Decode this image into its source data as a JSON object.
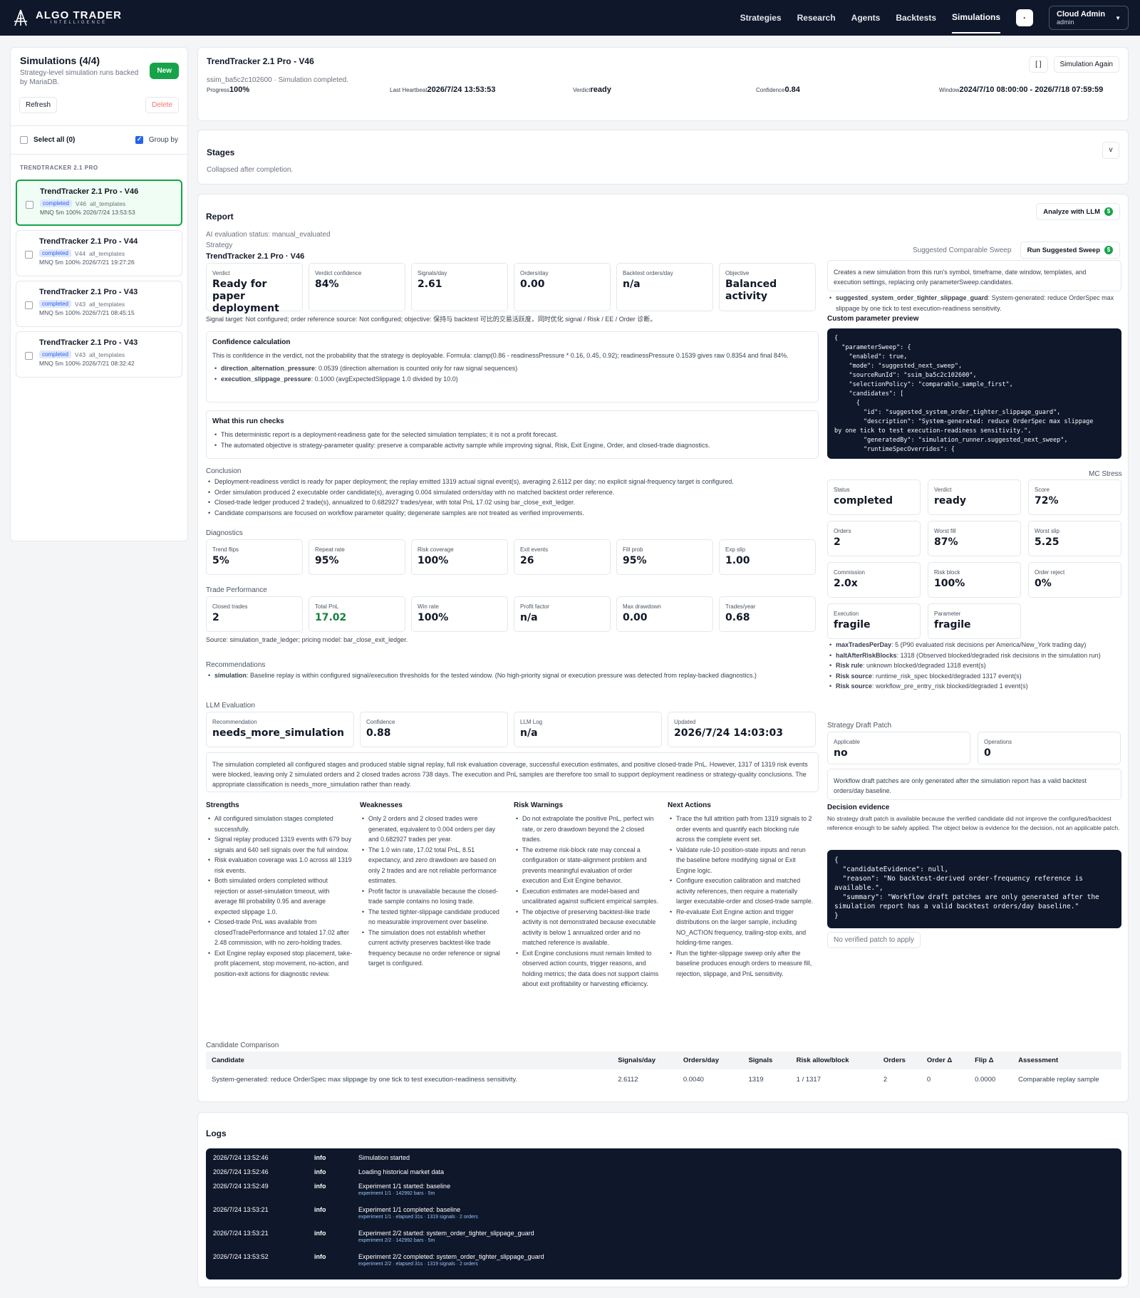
{
  "app": {
    "brand": "ALGO TRADER",
    "brand_sub": "INTELLIGENCE"
  },
  "nav": [
    "Strategies",
    "Research",
    "Agents",
    "Backtests",
    "Simulations"
  ],
  "nav_dot": "·",
  "user": {
    "name": "Cloud Admin",
    "role": "admin"
  },
  "sidebar": {
    "title": "Simulations (4/4)",
    "subtitle": "Strategy-level simulation runs backed by MariaDB.",
    "new": "New",
    "refresh": "Refresh",
    "delete": "Delete",
    "select_all": "Select all (0)",
    "group_by": "Group by",
    "group": "TRENDTRACKER 2.1 PRO",
    "items": [
      {
        "title": "TrendTracker 2.1 Pro - V46",
        "status": "completed",
        "ver": "V46",
        "tpl": "all_templates",
        "line": "MNQ  5m  100%  2026/7/24 13:53:53"
      },
      {
        "title": "TrendTracker 2.1 Pro - V44",
        "status": "completed",
        "ver": "V44",
        "tpl": "all_templates",
        "line": "MNQ  5m  100%  2026/7/21 19:27:26"
      },
      {
        "title": "TrendTracker 2.1 Pro - V43",
        "status": "completed",
        "ver": "V43",
        "tpl": "all_templates",
        "line": "MNQ  5m  100%  2026/7/21 08:45:15"
      },
      {
        "title": "TrendTracker 2.1 Pro - V43",
        "status": "completed",
        "ver": "V43",
        "tpl": "all_templates",
        "line": "MNQ  5m  100%  2026/7/21 08:32:42"
      }
    ]
  },
  "header": {
    "title": "TrendTracker 2.1 Pro - V46",
    "run": "ssim_ba5c2c102600 · Simulation completed.",
    "progress_lbl": "Progress",
    "progress": "100%",
    "hb_lbl": "Last Heartbeat",
    "hb": "2026/7/24 13:53:53",
    "verdict_lbl": "Verdict",
    "verdict": "ready",
    "conf_lbl": "Confidence",
    "conf": "0.84",
    "window_lbl": "Window",
    "window": "2024/7/10 08:00:00 - 2026/7/18 07:59:59",
    "expand": "[ ]",
    "again": "Simulation Again"
  },
  "stages": {
    "title": "Stages",
    "note": "Collapsed after completion.",
    "toggle": "v"
  },
  "report": {
    "title": "Report",
    "analyze": "Analyze with LLM",
    "analyze_icon": "$",
    "eval_status": "AI evaluation status: manual_evaluated",
    "strategy_lbl": "Strategy",
    "strategy": "TrendTracker 2.1 Pro · V46",
    "kpis": [
      {
        "l": "Verdict",
        "v": "Ready for paper deployment"
      },
      {
        "l": "Verdict confidence",
        "v": "84%"
      },
      {
        "l": "Signals/day",
        "v": "2.61"
      },
      {
        "l": "Orders/day",
        "v": "0.00"
      },
      {
        "l": "Backtest orders/day",
        "v": "n/a"
      },
      {
        "l": "Objective",
        "v": "Balanced activity"
      }
    ],
    "signal_target": "Signal target: Not configured; order reference source: Not configured; objective: 保持与 backtest 可比的交易活跃度，同时优化 signal / Risk / EE / Order 诊断。",
    "conf_calc": {
      "title": "Confidence calculation",
      "text": "This is confidence in the verdict, not the probability that the strategy is deployable. Formula: clamp(0.86 - readinessPressure * 0.16, 0.45, 0.92); readinessPressure 0.1539 gives raw 0.8354 and final 84%.",
      "items": [
        {
          "k": "direction_alternation_pressure",
          "v": ": 0.0539 (direction alternation is counted only for raw signal sequences)"
        },
        {
          "k": "execution_slippage_pressure",
          "v": ": 0.1000 (avgExpectedSlippage 1.0 divided by 10.0)"
        }
      ]
    },
    "checks": {
      "title": "What this run checks",
      "items": [
        "This deterministic report is a deployment-readiness gate for the selected simulation templates; it is not a profit forecast.",
        "The automated objective is strategy-parameter quality: preserve a comparable activity sample while improving signal, Risk, Exit Engine, Order, and closed-trade diagnostics."
      ]
    },
    "conclusion_lbl": "Conclusion",
    "conclusion": [
      "Deployment-readiness verdict is ready for paper deployment; the replay emitted 1319 actual signal event(s), averaging 2.6112 per day; no explicit signal-frequency target is configured.",
      "Order simulation produced 2 executable order candidate(s), averaging 0.004 simulated orders/day with no matched backtest order reference.",
      "Closed-trade ledger produced 2 trade(s), annualized to 0.682927 trades/year, with total PnL 17.02 using bar_close_exit_ledger.",
      "Candidate comparisons are focused on workflow parameter quality; degenerate samples are not treated as verified improvements."
    ],
    "diag_lbl": "Diagnostics",
    "diag": [
      {
        "l": "Trend flips",
        "v": "5%"
      },
      {
        "l": "Repeat rate",
        "v": "95%"
      },
      {
        "l": "Risk coverage",
        "v": "100%"
      },
      {
        "l": "Exit events",
        "v": "26"
      },
      {
        "l": "Fill prob",
        "v": "95%"
      },
      {
        "l": "Exp slip",
        "v": "1.00"
      }
    ],
    "trade_lbl": "Trade Performance",
    "trade": [
      {
        "l": "Closed trades",
        "v": "2"
      },
      {
        "l": "Total PnL",
        "v": "17.02"
      },
      {
        "l": "Win rate",
        "v": "100%"
      },
      {
        "l": "Profit factor",
        "v": "n/a"
      },
      {
        "l": "Max drawdown",
        "v": "0.00"
      },
      {
        "l": "Trades/year",
        "v": "0.68"
      }
    ],
    "source": "Source: simulation_trade_ledger; pricing model: bar_close_exit_ledger.",
    "rec_lbl": "Recommendations",
    "rec_k": "simulation",
    "rec_v": ": Baseline replay is within configured signal/execution thresholds for the tested window. (No high-priority signal or execution pressure was detected from replay-backed diagnostics.)",
    "llm_lbl": "LLM Evaluation",
    "llm": [
      {
        "l": "Recommendation",
        "v": "needs_more_simulation"
      },
      {
        "l": "Confidence",
        "v": "0.88"
      },
      {
        "l": "LLM Log",
        "v": "n/a"
      },
      {
        "l": "Updated",
        "v": "2026/7/24 14:03:03"
      }
    ],
    "llm_text": "The simulation completed all configured stages and produced stable signal replay, full risk evaluation coverage, successful execution estimates, and positive closed-trade PnL. However, 1317 of 1319 risk events were blocked, leaving only 2 simulated orders and 2 closed trades across 738 days. The execution and PnL samples are therefore too small to support deployment readiness or strategy-quality conclusions. The appropriate classification is needs_more_simulation rather than ready.",
    "cols": [
      {
        "t": "Strengths",
        "items": [
          "All configured simulation stages completed successfully.",
          "Signal replay produced 1319 events with 679 buy signals and 640 sell signals over the full window.",
          "Risk evaluation coverage was 1.0 across all 1319 risk events.",
          "Both simulated orders completed without rejection or asset-simulation timeout, with average fill probability 0.95 and average expected slippage 1.0.",
          "Closed-trade PnL was available from closedTradePerformance and totaled 17.02 after 2.48 commission, with no zero-holding trades.",
          "Exit Engine replay exposed stop placement, take-profit placement, stop movement, no-action, and position-exit actions for diagnostic review."
        ]
      },
      {
        "t": "Weaknesses",
        "items": [
          "Only 2 orders and 2 closed trades were generated, equivalent to 0.004 orders per day and 0.682927 trades per year.",
          "The 1.0 win rate, 17.02 total PnL, 8.51 expectancy, and zero drawdown are based on only 2 trades and are not reliable performance estimates.",
          "Profit factor is unavailable because the closed-trade sample contains no losing trade.",
          "The tested tighter-slippage candidate produced no measurable improvement over baseline.",
          "The simulation does not establish whether current activity preserves backtest-like trade frequency because no order reference or signal target is configured."
        ]
      },
      {
        "t": "Risk Warnings",
        "items": [
          "Do not extrapolate the positive PnL, perfect win rate, or zero drawdown beyond the 2 closed trades.",
          "The extreme risk-block rate may conceal a configuration or state-alignment problem and prevents meaningful evaluation of order execution and Exit Engine behavior.",
          "Execution estimates are model-based and uncalibrated against sufficient empirical samples.",
          "The objective of preserving backtest-like trade activity is not demonstrated because executable activity is below 1 annualized order and no matched reference is available.",
          "Exit Engine conclusions must remain limited to observed action counts, trigger reasons, and holding metrics; the data does not support claims about exit profitability or harvesting efficiency."
        ]
      },
      {
        "t": "Next Actions",
        "items": [
          "Trace the full attrition path from 1319 signals to 2 order events and quantify each blocking rule across the complete event set.",
          "Validate rule-10 position-state inputs and rerun the baseline before modifying signal or Exit Engine logic.",
          "Configure execution calibration and matched activity references, then require a materially larger executable-order and closed-trade sample.",
          "Re-evaluate Exit Engine action and trigger distributions on the larger sample, including NO_ACTION frequency, trailing-stop exits, and holding-time ranges.",
          "Run the tighter-slippage sweep only after the baseline produces enough orders to measure fill, rejection, slippage, and PnL sensitivity."
        ]
      }
    ],
    "cand_lbl": "Candidate Comparison",
    "cand_head": [
      "Candidate",
      "Signals/day",
      "Orders/day",
      "Signals",
      "Risk allow/block",
      "Orders",
      "Order Δ",
      "Flip Δ",
      "Assessment"
    ],
    "cand_row": [
      "System-generated: reduce OrderSpec max slippage by one tick to test execution-readiness sensitivity.",
      "2.6112",
      "0.0040",
      "1319",
      "1 / 1317",
      "2",
      "0",
      "0.0000",
      "Comparable replay sample"
    ],
    "sweep_lbl": "Suggested Comparable Sweep",
    "sweep_btn": "Run Suggested Sweep",
    "sweep_icon": "$",
    "sweep_text": "Creates a new simulation from this run's symbol, timeframe, date window, templates, and execution settings, replacing only parameterSweep.candidates.",
    "sweep_k": "suggested_system_order_tighter_slippage_guard",
    "sweep_v": ": System-generated: reduce OrderSpec max slippage by one tick to test execution-readiness sensitivity.",
    "preview_lbl": "Custom parameter preview",
    "preview_code": "{\n  \"parameterSweep\": {\n    \"enabled\": true,\n    \"mode\": \"suggested_next_sweep\",\n    \"sourceRunId\": \"ssim_ba5c2c102600\",\n    \"selectionPolicy\": \"comparable_sample_first\",\n    \"candidates\": [\n      {\n        \"id\": \"suggested_system_order_tighter_slippage_guard\",\n        \"description\": \"System-generated: reduce OrderSpec max slippage\nby one tick to test execution-readiness sensitivity.\",\n        \"generatedBy\": \"simulation_runner.suggested_next_sweep\",\n        \"runtimeSpecOverrides\": {",
    "mc_lbl": "MC Stress",
    "mc": [
      {
        "l": "Status",
        "v": "completed"
      },
      {
        "l": "Verdict",
        "v": "ready"
      },
      {
        "l": "Score",
        "v": "72%"
      },
      {
        "l": "Orders",
        "v": "2"
      },
      {
        "l": "Worst fill",
        "v": "87%"
      },
      {
        "l": "Worst slip",
        "v": "5.25"
      },
      {
        "l": "Commission",
        "v": "2.0x"
      },
      {
        "l": "Risk block",
        "v": "100%"
      },
      {
        "l": "Order reject",
        "v": "0%"
      },
      {
        "l": "Execution",
        "v": "fragile"
      },
      {
        "l": "Parameter",
        "v": "fragile"
      }
    ],
    "mc_notes": [
      {
        "k": "maxTradesPerDay",
        "v": ": 5 (P90 evaluated risk decisions per America/New_York trading day)"
      },
      {
        "k": "haltAfterRiskBlocks",
        "v": ": 1318 (Observed blocked/degraded risk decisions in the simulation run)"
      },
      {
        "k": "Risk rule",
        "v": ": unknown blocked/degraded 1318 event(s)"
      },
      {
        "k": "Risk source",
        "v": ": runtime_risk_spec blocked/degraded 1317 event(s)"
      },
      {
        "k": "Risk source",
        "v": ": workflow_pre_entry_risk blocked/degraded 1 event(s)"
      }
    ],
    "patch_lbl": "Strategy Draft Patch",
    "patch": [
      {
        "l": "Applicable",
        "v": "no"
      },
      {
        "l": "Operations",
        "v": "0"
      }
    ],
    "patch_note": "Workflow draft patches are only generated after the simulation report has a valid backtest orders/day baseline.",
    "evidence_lbl": "Decision evidence",
    "evidence_text": "No strategy draft patch is available because the verified candidate did not improve the configured/backtest reference enough to be safely applied. The object below is evidence for the decision, not an applicable patch.",
    "evidence_code": "{\n  \"candidateEvidence\": null,\n  \"reason\": \"No backtest-derived order-frequency reference is\navailable.\",\n  \"summary\": \"Workflow draft patches are only generated after the\nsimulation report has a valid backtest orders/day baseline.\"\n}",
    "no_patch": "No verified patch to apply"
  },
  "logs": {
    "title": "Logs",
    "rows": [
      {
        "t": "2026/7/24 13:52:46",
        "lv": "info",
        "m": "Simulation started",
        "s": ""
      },
      {
        "t": "2026/7/24 13:52:46",
        "lv": "info",
        "m": "Loading historical market data",
        "s": ""
      },
      {
        "t": "2026/7/24 13:52:49",
        "lv": "info",
        "m": "Experiment 1/1 started: baseline",
        "s": "experiment 1/1 · 142992 bars · 5m"
      },
      {
        "t": "2026/7/24 13:53:21",
        "lv": "info",
        "m": "Experiment 1/1 completed: baseline",
        "s": "experiment 1/1 · elapsed 31s · 1319 signals · 2 orders"
      },
      {
        "t": "2026/7/24 13:53:21",
        "lv": "info",
        "m": "Experiment 2/2 started: system_order_tighter_slippage_guard",
        "s": "experiment 2/2 · 142992 bars · 5m"
      },
      {
        "t": "2026/7/24 13:53:52",
        "lv": "info",
        "m": "Experiment 2/2 completed: system_order_tighter_slippage_guard",
        "s": "experiment 2/2 · elapsed 31s · 1319 signals · 2 orders"
      }
    ]
  }
}
